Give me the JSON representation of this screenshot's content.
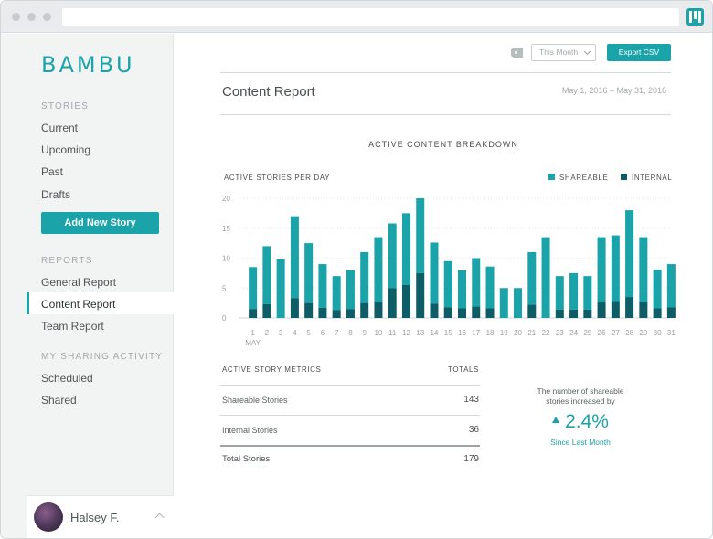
{
  "app": {
    "logo": "BAMBU"
  },
  "sidebar": {
    "stories_label": "STORIES",
    "stories": [
      "Current",
      "Upcoming",
      "Past",
      "Drafts"
    ],
    "add_story_label": "Add New Story",
    "reports_label": "REPORTS",
    "reports": [
      "General Report",
      "Content Report",
      "Team Report"
    ],
    "active_report": "Content Report",
    "sharing_label": "MY SHARING ACTIVITY",
    "sharing": [
      "Scheduled",
      "Shared"
    ],
    "user_name": "Halsey F."
  },
  "toolbar": {
    "period_select": "This Month",
    "export_label": "Export CSV"
  },
  "page": {
    "title": "Content Report",
    "date_range": "May 1, 2016 – May 31, 2016"
  },
  "colors": {
    "accent": "#1aa3a8",
    "shareable": "#1aa3a8",
    "internal": "#0d5d67"
  },
  "chart_data": {
    "type": "bar",
    "title": "ACTIVE CONTENT BREAKDOWN",
    "ylabel": "ACTIVE STORIES PER DAY",
    "xlabel": "MAY",
    "stacked": true,
    "ylim": [
      0,
      20
    ],
    "yticks": [
      0,
      5,
      10,
      15,
      20
    ],
    "legend_position": "top-right",
    "categories": [
      "1",
      "2",
      "3",
      "4",
      "5",
      "6",
      "7",
      "8",
      "9",
      "10",
      "11",
      "12",
      "13",
      "14",
      "15",
      "16",
      "17",
      "18",
      "19",
      "20",
      "21",
      "22",
      "23",
      "24",
      "25",
      "26",
      "27",
      "28",
      "29",
      "30",
      "31"
    ],
    "series": [
      {
        "name": "INTERNAL",
        "values": [
          1.5,
          2.3,
          0,
          3.3,
          2.5,
          1.7,
          1.3,
          1.5,
          2.5,
          2.6,
          5,
          5.5,
          7.5,
          2.4,
          1.8,
          1.6,
          1.9,
          1.6,
          0,
          0,
          2.2,
          0,
          1.4,
          1.4,
          1.4,
          2.6,
          2.7,
          3.5,
          2.6,
          1.6,
          1.8
        ]
      },
      {
        "name": "SHAREABLE",
        "values": [
          7,
          9.7,
          9.8,
          13.7,
          10,
          7.3,
          5.7,
          6.5,
          8.5,
          10.9,
          10.8,
          12,
          12.5,
          10.2,
          7.7,
          6.4,
          8.1,
          7,
          5,
          5,
          8.8,
          13.5,
          5.6,
          6.1,
          5.6,
          10.9,
          11.1,
          14.5,
          10.9,
          6.5,
          7.2
        ]
      }
    ]
  },
  "metrics": {
    "header_label": "ACTIVE STORY METRICS",
    "header_totals": "TOTALS",
    "rows": [
      {
        "label": "Shareable Stories",
        "value": "143"
      },
      {
        "label": "Internal Stories",
        "value": "36"
      }
    ],
    "total": {
      "label": "Total Stories",
      "value": "179"
    }
  },
  "callout": {
    "text": "The number of shareable stories increased by",
    "percent": "2.4%",
    "since": "Since Last Month"
  }
}
